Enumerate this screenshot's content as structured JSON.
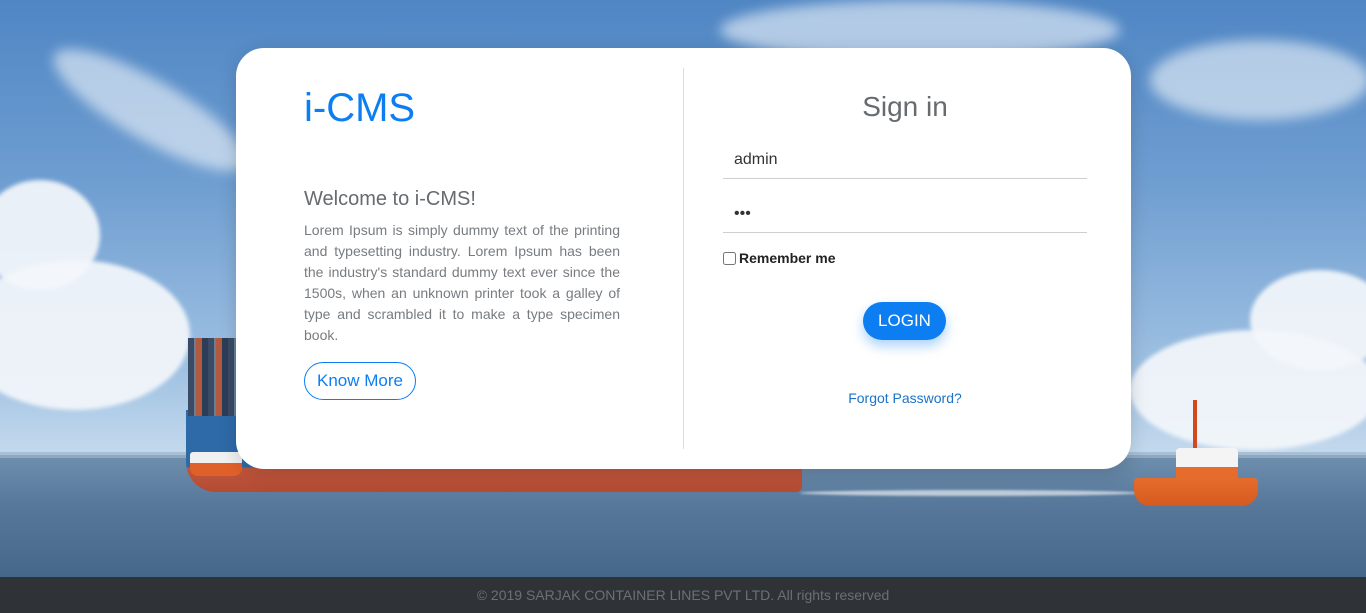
{
  "brand": {
    "name": "i-CMS"
  },
  "intro": {
    "heading": "Welcome to i-CMS!",
    "body": "Lorem Ipsum is simply dummy text of the printing and typesetting industry. Lorem Ipsum has been the industry's standard dummy text ever since the 1500s, when an unknown printer took a galley of type and scrambled it to make a type specimen book.",
    "know_more_label": "Know More"
  },
  "signin": {
    "title": "Sign in",
    "username_value": "admin",
    "password_value": "•••",
    "remember_label": "Remember me",
    "remember_checked": false,
    "login_label": "LOGIN",
    "forgot_label": "Forgot Password?"
  },
  "footer": {
    "text": "© 2019 SARJAK CONTAINER LINES PVT LTD. All rights reserved"
  },
  "colors": {
    "accent": "#0d7ef2",
    "footer_bg": "#2f3338"
  }
}
